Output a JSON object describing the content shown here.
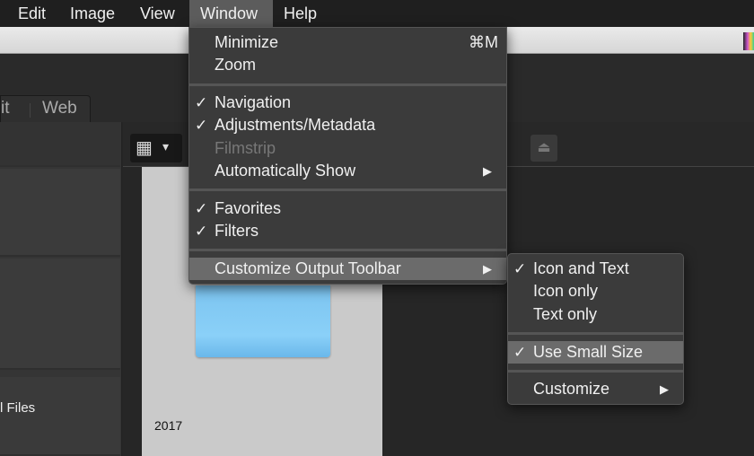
{
  "menubar": {
    "items": [
      "Edit",
      "Image",
      "View",
      "Window",
      "Help"
    ],
    "active": "Window"
  },
  "tabs": {
    "items": [
      "it",
      "Web"
    ]
  },
  "sidebar": {
    "visible_text": "l Files"
  },
  "content": {
    "folder_label": "2017",
    "folder_color": "#8ad0f8"
  },
  "window_menu": {
    "minimize": {
      "label": "Minimize",
      "shortcut": "⌘M"
    },
    "zoom": {
      "label": "Zoom"
    },
    "navigation": {
      "label": "Navigation",
      "checked": true
    },
    "adjustments": {
      "label": "Adjustments/Metadata",
      "checked": true
    },
    "filmstrip": {
      "label": "Filmstrip",
      "disabled": true
    },
    "auto_show": {
      "label": "Automatically Show"
    },
    "favorites": {
      "label": "Favorites",
      "checked": true
    },
    "filters": {
      "label": "Filters",
      "checked": true
    },
    "customize_toolbar": {
      "label": "Customize Output Toolbar",
      "highlighted": true
    }
  },
  "submenu": {
    "icon_and_text": {
      "label": "Icon and Text",
      "checked": true
    },
    "icon_only": {
      "label": "Icon only"
    },
    "text_only": {
      "label": "Text only"
    },
    "small_size": {
      "label": "Use Small Size",
      "checked": true,
      "highlighted": true
    },
    "customize": {
      "label": "Customize"
    }
  },
  "glyphs": {
    "check": "✓",
    "arrow": "▶",
    "grid": "▦",
    "caret": "▾",
    "export": "⏏"
  }
}
